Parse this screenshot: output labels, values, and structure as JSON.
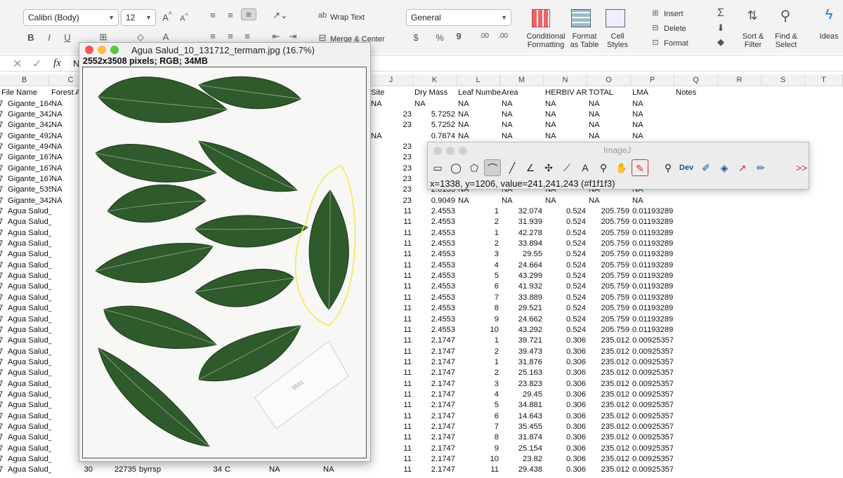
{
  "ribbon": {
    "font_name": "Calibri (Body)",
    "font_size": "12",
    "grow_font": "A^",
    "shrink_font": "A^",
    "bold": "B",
    "italic": "I",
    "underline": "U",
    "wrap_text": "Wrap Text",
    "merge_center": "Merge & Center",
    "number_format": "General",
    "currency": "$",
    "percent": "%",
    "comma": "9",
    "inc_decimal": ".00",
    "dec_decimal": ".00",
    "conditional_formatting": "Conditional Formatting",
    "format_as_table": "Format as Table",
    "cell_styles": "Cell Styles",
    "insert": "Insert",
    "delete": "Delete",
    "format": "Format",
    "sort_filter": "Sort & Filter",
    "find_select": "Find & Select",
    "ideas": "Ideas"
  },
  "formula_bar": {
    "fx": "fx",
    "content": "N"
  },
  "columns": [
    "B",
    "C",
    "J",
    "K",
    "L",
    "M",
    "N",
    "O",
    "P",
    "Q",
    "R",
    "S",
    "T"
  ],
  "headers": {
    "b": "File Name",
    "c": "Forest A",
    "j": "Site",
    "k": "Dry Mass",
    "l": "Leaf Number",
    "m": "Area",
    "n": "HERBIV AREA",
    "o": "TOTAL",
    "p": "LMA",
    "q": "Notes"
  },
  "rows": [
    {
      "b": "Gigante_164",
      "c": "NA",
      "j": "NA",
      "k": "NA",
      "l": "NA",
      "m": "NA",
      "n": "NA",
      "o": "NA",
      "p": "NA"
    },
    {
      "b": "Gigante_342",
      "c": "NA",
      "j": "23",
      "k": "5.7252",
      "l": "NA",
      "m": "NA",
      "n": "NA",
      "o": "NA",
      "p": "NA"
    },
    {
      "b": "Gigante_342",
      "c": "NA",
      "j": "23",
      "k": "5.7252",
      "l": "NA",
      "m": "NA",
      "n": "NA",
      "o": "NA",
      "p": "NA"
    },
    {
      "b": "Gigante_492",
      "c": "NA",
      "j": "NA",
      "k": "0.7674",
      "l": "NA",
      "m": "NA",
      "n": "NA",
      "o": "NA",
      "p": "NA"
    },
    {
      "b": "Gigante_494",
      "c": "NA",
      "j": "23",
      "k": "",
      "l": "",
      "m": "",
      "n": "",
      "o": "",
      "p": ""
    },
    {
      "b": "Gigante_167",
      "c": "NA",
      "j": "23",
      "k": "",
      "l": "",
      "m": "",
      "n": "",
      "o": "",
      "p": ""
    },
    {
      "b": "Gigante_167",
      "c": "NA",
      "j": "23",
      "k": "",
      "l": "",
      "m": "",
      "n": "",
      "o": "",
      "p": ""
    },
    {
      "b": "Gigante_167",
      "c": "NA",
      "j": "23",
      "k": "",
      "l": "",
      "m": "",
      "n": "",
      "o": "",
      "p": ""
    },
    {
      "b": "Gigante_535",
      "c": "NA",
      "j": "23",
      "k": "2.0133",
      "l": "NA",
      "m": "NA",
      "n": "NA",
      "o": "NA",
      "p": "NA"
    },
    {
      "b": "Gigante_342",
      "c": "NA",
      "j": "23",
      "k": "0.9049",
      "l": "NA",
      "m": "NA",
      "n": "NA",
      "o": "NA",
      "p": "NA"
    },
    {
      "b": "Agua Salud_",
      "c": "",
      "j": "11",
      "k": "2.4553",
      "l": "1",
      "m": "32.074",
      "n": "0.524",
      "o": "205.759",
      "p": "0.01193289"
    },
    {
      "b": "Agua Salud_",
      "c": "",
      "j": "11",
      "k": "2.4553",
      "l": "2",
      "m": "31.939",
      "n": "0.524",
      "o": "205.759",
      "p": "0.01193289"
    },
    {
      "b": "Agua Salud_",
      "c": "",
      "j": "11",
      "k": "2.4553",
      "l": "1",
      "m": "42.278",
      "n": "0.524",
      "o": "205.759",
      "p": "0.01193289"
    },
    {
      "b": "Agua Salud_",
      "c": "",
      "j": "11",
      "k": "2.4553",
      "l": "2",
      "m": "33.894",
      "n": "0.524",
      "o": "205.759",
      "p": "0.01193289"
    },
    {
      "b": "Agua Salud_",
      "c": "",
      "j": "11",
      "k": "2.4553",
      "l": "3",
      "m": "29.55",
      "n": "0.524",
      "o": "205.759",
      "p": "0.01193289"
    },
    {
      "b": "Agua Salud_",
      "c": "",
      "j": "11",
      "k": "2.4553",
      "l": "4",
      "m": "24.664",
      "n": "0.524",
      "o": "205.759",
      "p": "0.01193289"
    },
    {
      "b": "Agua Salud_",
      "c": "",
      "j": "11",
      "k": "2.4553",
      "l": "5",
      "m": "43.299",
      "n": "0.524",
      "o": "205.759",
      "p": "0.01193289"
    },
    {
      "b": "Agua Salud_",
      "c": "",
      "j": "11",
      "k": "2.4553",
      "l": "6",
      "m": "41.932",
      "n": "0.524",
      "o": "205.759",
      "p": "0.01193289"
    },
    {
      "b": "Agua Salud_",
      "c": "",
      "j": "11",
      "k": "2.4553",
      "l": "7",
      "m": "33.889",
      "n": "0.524",
      "o": "205.759",
      "p": "0.01193289"
    },
    {
      "b": "Agua Salud_",
      "c": "",
      "j": "11",
      "k": "2.4553",
      "l": "8",
      "m": "29.521",
      "n": "0.524",
      "o": "205.759",
      "p": "0.01193289"
    },
    {
      "b": "Agua Salud_",
      "c": "",
      "j": "11",
      "k": "2.4553",
      "l": "9",
      "m": "24.662",
      "n": "0.524",
      "o": "205.759",
      "p": "0.01193289"
    },
    {
      "b": "Agua Salud_",
      "c": "",
      "j": "11",
      "k": "2.4553",
      "l": "10",
      "m": "43.292",
      "n": "0.524",
      "o": "205.759",
      "p": "0.01193289"
    },
    {
      "b": "Agua Salud_",
      "c": "",
      "j": "11",
      "k": "2.1747",
      "l": "1",
      "m": "39.721",
      "n": "0.306",
      "o": "235.012",
      "p": "0.00925357"
    },
    {
      "b": "Agua Salud_",
      "c": "",
      "j": "11",
      "k": "2.1747",
      "l": "2",
      "m": "39.473",
      "n": "0.306",
      "o": "235.012",
      "p": "0.00925357"
    },
    {
      "b": "Agua Salud_",
      "c": "",
      "j": "11",
      "k": "2.1747",
      "l": "1",
      "m": "31.876",
      "n": "0.306",
      "o": "235.012",
      "p": "0.00925357"
    },
    {
      "b": "Agua Salud_",
      "c": "",
      "j": "11",
      "k": "2.1747",
      "l": "2",
      "m": "25.163",
      "n": "0.306",
      "o": "235.012",
      "p": "0.00925357"
    },
    {
      "b": "Agua Salud_",
      "c": "",
      "j": "11",
      "k": "2.1747",
      "l": "3",
      "m": "23.823",
      "n": "0.306",
      "o": "235.012",
      "p": "0.00925357"
    },
    {
      "b": "Agua Salud_",
      "c": "",
      "j": "11",
      "k": "2.1747",
      "l": "4",
      "m": "29.45",
      "n": "0.306",
      "o": "235.012",
      "p": "0.00925357"
    },
    {
      "b": "Agua Salud_",
      "c": "",
      "j": "11",
      "k": "2.1747",
      "l": "5",
      "m": "34.881",
      "n": "0.306",
      "o": "235.012",
      "p": "0.00925357"
    },
    {
      "b": "Agua Salud_",
      "c": "",
      "j": "11",
      "k": "2.1747",
      "l": "6",
      "m": "14.643",
      "n": "0.306",
      "o": "235.012",
      "p": "0.00925357"
    },
    {
      "b": "Agua Salud_",
      "c": "",
      "j": "11",
      "k": "2.1747",
      "l": "7",
      "m": "35.455",
      "n": "0.306",
      "o": "235.012",
      "p": "0.00925357"
    },
    {
      "b": "Agua Salud_",
      "c": "",
      "j": "11",
      "k": "2.1747",
      "l": "8",
      "m": "31.874",
      "n": "0.306",
      "o": "235.012",
      "p": "0.00925357"
    },
    {
      "b": "Agua Salud_",
      "c": "",
      "j": "11",
      "k": "2.1747",
      "l": "9",
      "m": "25.154",
      "n": "0.306",
      "o": "235.012",
      "p": "0.00925357"
    },
    {
      "b": "Agua Salud_",
      "c": "",
      "j": "11",
      "k": "2.1747",
      "l": "10",
      "m": "23.82",
      "n": "0.306",
      "o": "235.012",
      "p": "0.00925357"
    },
    {
      "b": "Agua Salud_",
      "c": "30",
      "j": "11",
      "k": "2.1747",
      "l": "11",
      "m": "29.438",
      "n": "0.306",
      "o": "235.012",
      "p": "0.00925357"
    }
  ],
  "last_row_extra": {
    "d": "22735",
    "e": "byrrsp",
    "g": "34",
    "h": "C",
    "i": "NA",
    "i2": "NA"
  },
  "image_window": {
    "title": "Agua Salud_10_131712_termam.jpg (16.7%)",
    "info": "2552x3508 pixels; RGB; 34MB",
    "label_text": "5501"
  },
  "imagej": {
    "title": "ImageJ",
    "status": "x=1338, y=1206, value=241,241,243 (#f1f1f3)",
    "dev_label": "Dev",
    "more": ">>"
  },
  "colors": {
    "leaf": "#2f5a2c",
    "leaf_dark": "#223f22",
    "selection": "#f2e94a",
    "accent": "#1a73c8"
  }
}
